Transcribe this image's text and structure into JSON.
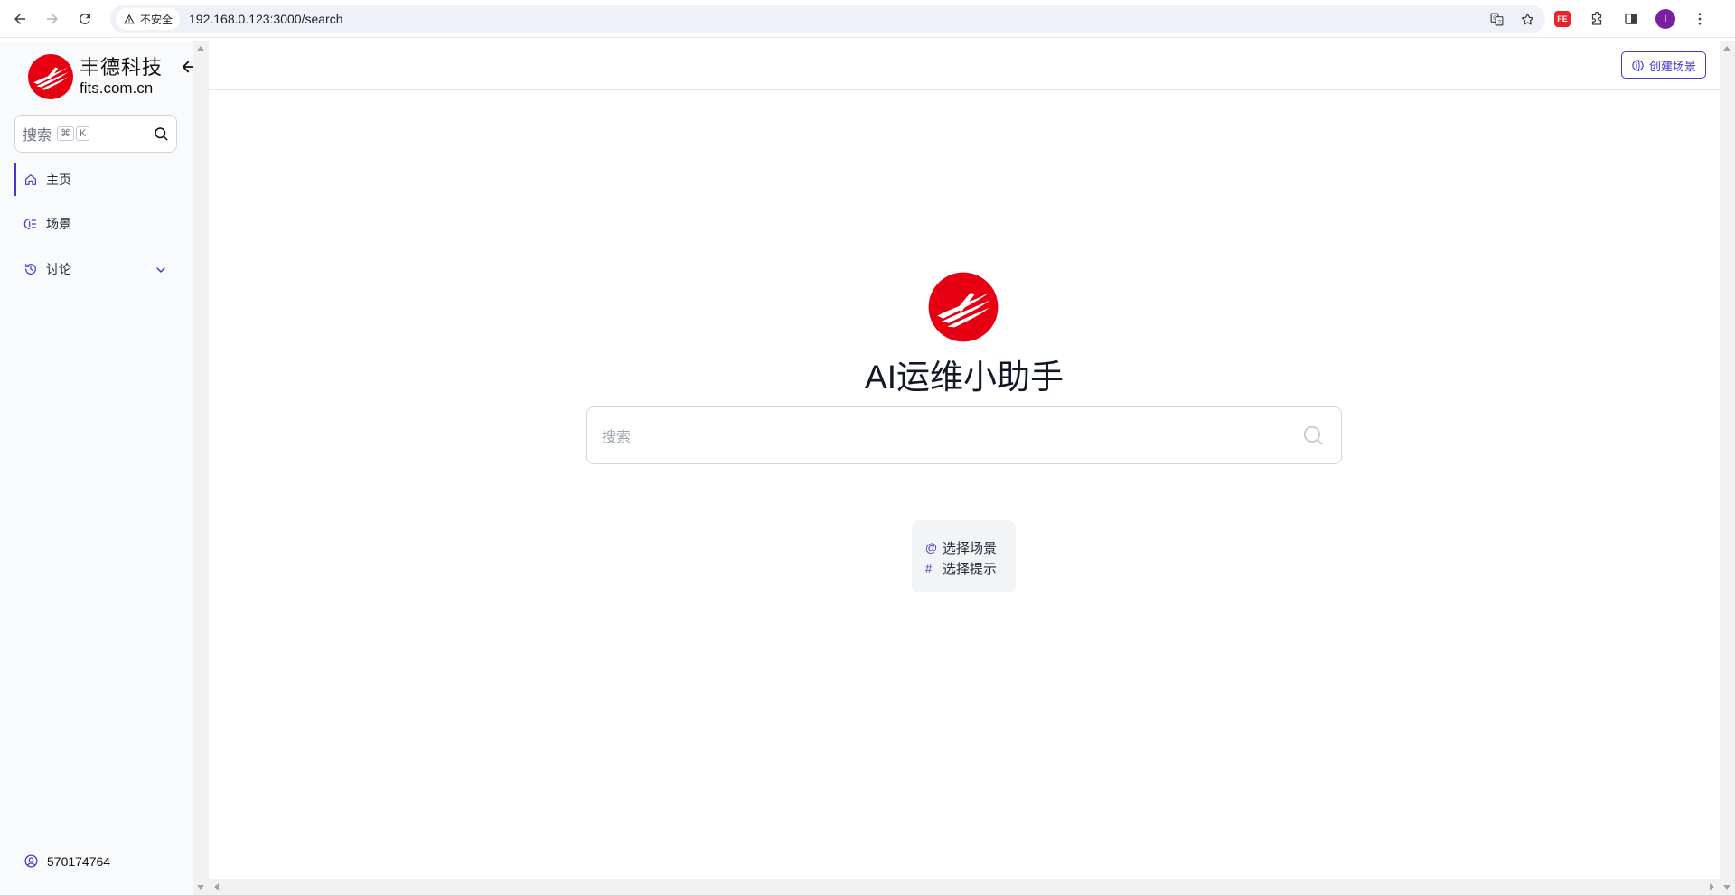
{
  "browser": {
    "security_label": "不安全",
    "url": "192.168.0.123:3000/search",
    "extension_label": "FE",
    "profile_initial": "I"
  },
  "sidebar": {
    "brand_cn": "丰德科技",
    "brand_en": "fits.com.cn",
    "search_placeholder": "搜索",
    "shortcut_keys": [
      "⌘",
      "K"
    ],
    "items": [
      {
        "label": "主页",
        "icon": "home-icon",
        "active": true
      },
      {
        "label": "场景",
        "icon": "scene-icon",
        "active": false
      },
      {
        "label": "讨论",
        "icon": "history-icon",
        "active": false,
        "expandable": true
      }
    ],
    "user_id": "570174764"
  },
  "main": {
    "create_button_label": "创建场景",
    "title": "AI运维小助手",
    "search_placeholder": "搜索",
    "hints": [
      {
        "symbol": "@",
        "label": "选择场景"
      },
      {
        "symbol": "#",
        "label": "选择提示"
      }
    ]
  },
  "colors": {
    "accent": "#4338ca",
    "brand_red": "#e60012",
    "sidebar_bg": "#f9fafb"
  }
}
